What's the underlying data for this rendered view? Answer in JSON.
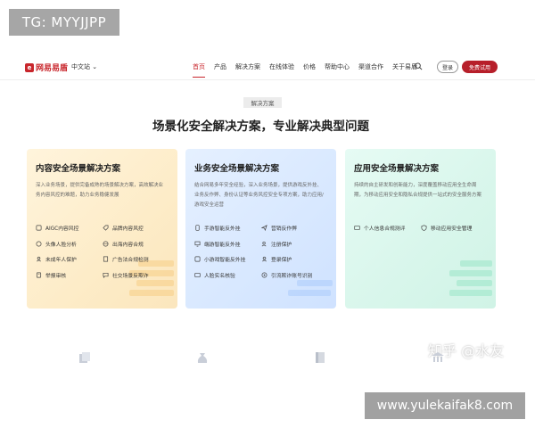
{
  "watermarks": {
    "top": "TG: MYYJJPP",
    "bottom": "www.yulekaifak8.com",
    "zhihu": "知乎 @水友"
  },
  "nav": {
    "logo_text": "网易易盾",
    "logo_mark": "e",
    "lang": "中文站",
    "menu": [
      {
        "label": "首页",
        "active": true
      },
      {
        "label": "产品",
        "active": false
      },
      {
        "label": "解决方案",
        "active": false
      },
      {
        "label": "在线体验",
        "active": false
      },
      {
        "label": "价格",
        "active": false
      },
      {
        "label": "帮助中心",
        "active": false
      },
      {
        "label": "渠道合作",
        "active": false
      },
      {
        "label": "关于易盾",
        "active": false
      }
    ],
    "login": "登录",
    "trial": "免费试用"
  },
  "section": {
    "badge": "解决方案",
    "headline": "场景化安全解决方案，专业解决典型问题"
  },
  "cards": [
    {
      "title": "内容安全场景解决方案",
      "desc": "深入业务场景，提供完备成熟的场景解决方案，高效解决业务内容风控的难题，助力业务稳健发展",
      "features": [
        "AIGC内容风控",
        "品牌内容风控",
        "头像人脸分析",
        "出海内容合规",
        "未成年人保护",
        "广告法合规检测",
        "举报审核",
        "社交场景反欺诈"
      ]
    },
    {
      "title": "业务安全场景解决方案",
      "desc": "结合网易多年安全经验，深入业务场景，提供游戏反外挂、业务反作弊、身份认证等业务风控安全专项方案，助力应用/游戏安全运营",
      "features": [
        "手游智能反外挂",
        "营销反作弊",
        "端游智能反外挂",
        "注册保护",
        "小游戏智能反外挂",
        "登录保护",
        "人脸实名核验",
        "引流欺诈账号识别"
      ]
    },
    {
      "title": "应用安全场景解决方案",
      "desc": "持续的自主研发和创新能力，深度覆盖移动应用全生命周期，为移动应用安全和隐私合规提供一站式的安全服务方案",
      "features": [
        "个人信息合规测评",
        "移动应用安全管理"
      ]
    }
  ],
  "colors": {
    "brand": "#c8262c",
    "trial_button": "#b71f2a",
    "card_warm": "#fdecc8",
    "card_blue": "#d8e8ff",
    "card_mint": "#d8f6eb"
  },
  "icons": {
    "search": "search-icon",
    "bottom": [
      "cube-stack-icon",
      "money-bag-icon",
      "book-icon",
      "bank-icon"
    ]
  }
}
